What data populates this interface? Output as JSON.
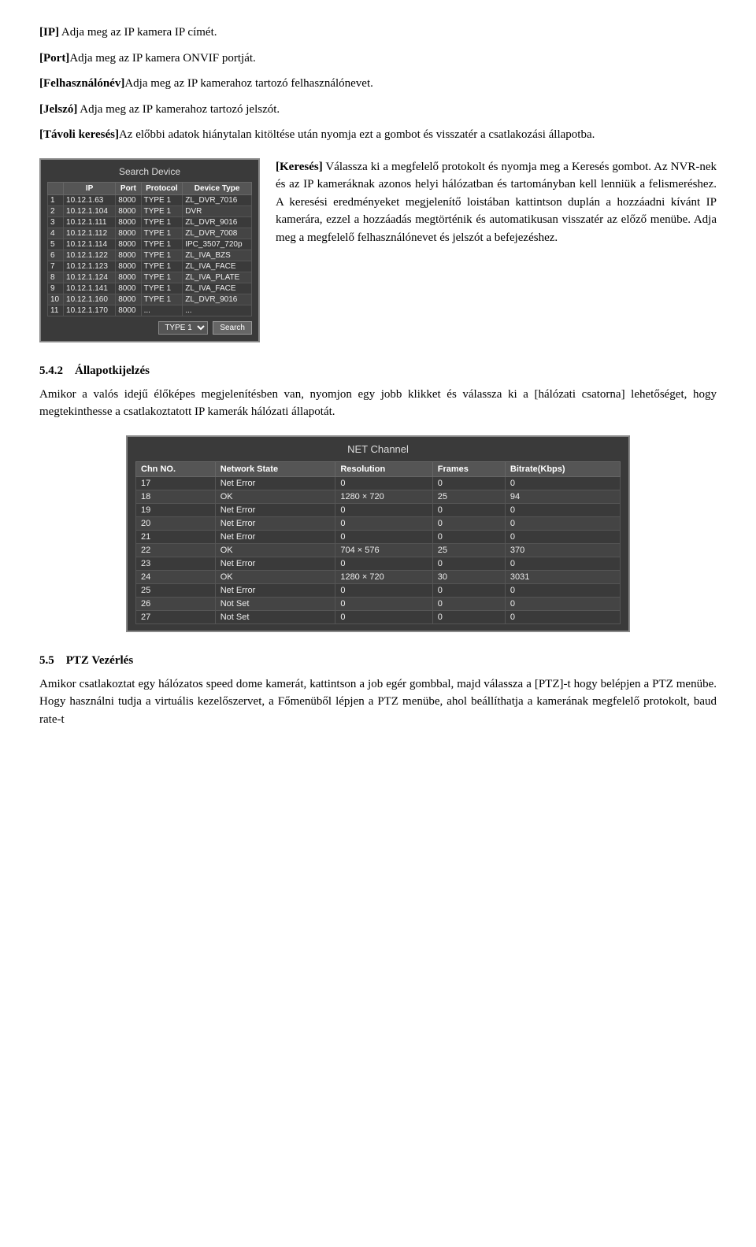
{
  "paragraphs": {
    "ip_label": "[IP]",
    "ip_text": " Adja meg az IP kamera IP címét.",
    "port_label": "[Port]",
    "port_text": "Adja meg az IP kamera ONVIF portját.",
    "username_label": "[Felhasználónév]",
    "username_text": "Adja meg az IP kamerahoz tartozó felhasználónevet.",
    "password_label": "[Jelszó]",
    "password_text": " Adja meg az IP kamerahoz tartozó jelszót.",
    "remote_label": "[Távoli keresés]",
    "remote_text": "Az előbbi adatok hiánytalan kitöltése után nyomja ezt a gombot és visszatér a csatlakozási állapotba."
  },
  "device_dialog": {
    "title": "Search Device",
    "columns": [
      "",
      "IP",
      "Port",
      "Protocol",
      "Device Type"
    ],
    "rows": [
      [
        "1",
        "10.12.1.63",
        "8000",
        "TYPE 1",
        "ZL_DVR_7016"
      ],
      [
        "2",
        "10.12.1.104",
        "8000",
        "TYPE 1",
        "DVR"
      ],
      [
        "3",
        "10.12.1.111",
        "8000",
        "TYPE 1",
        "ZL_DVR_9016"
      ],
      [
        "4",
        "10.12.1.112",
        "8000",
        "TYPE 1",
        "ZL_DVR_7008"
      ],
      [
        "5",
        "10.12.1.114",
        "8000",
        "TYPE 1",
        "IPC_3507_720p"
      ],
      [
        "6",
        "10.12.1.122",
        "8000",
        "TYPE 1",
        "ZL_IVA_BZS"
      ],
      [
        "7",
        "10.12.1.123",
        "8000",
        "TYPE 1",
        "ZL_IVA_FACE"
      ],
      [
        "8",
        "10.12.1.124",
        "8000",
        "TYPE 1",
        "ZL_IVA_PLATE"
      ],
      [
        "9",
        "10.12.1.141",
        "8000",
        "TYPE 1",
        "ZL_IVA_FACE"
      ],
      [
        "10",
        "10.12.1.160",
        "8000",
        "TYPE 1",
        "ZL_DVR_9016"
      ],
      [
        "11",
        "10.12.1.170",
        "8000",
        "...",
        "..."
      ]
    ],
    "dropdown_value": "TYPE 1",
    "search_button": "Search"
  },
  "right_column": {
    "keresés_label": "[Keresés]",
    "keresés_text1": "Válassza ki a megfelelő protokolt és nyomja meg a Keresés gombot. Az NVR-nek és az IP kameráknak azonos helyi hálózatban és tartományban kell lenniük a felismeréshez. A keresési eredményeket megjelenítő loistában kattintson duplán a hozzáadni kívánt IP kamerára, ezzel a hozzáadás megtörténik és automatikusan visszatér az előző menübe. Adja meg a megfelelő felhasználónevet és jelszót a befejezéshez."
  },
  "section_542": {
    "number": "5.4.2",
    "title": "Állapotkijelzés",
    "paragraph": "Amikor a valós idejű élőképes megjelenítésben van, nyomjon egy jobb klikket és válassza ki a [hálózati csatorna] lehetőséget, hogy megtekinthesse a csatlakoztatott IP kamerák hálózati állapotát."
  },
  "net_channel": {
    "title": "NET Channel",
    "columns": [
      "Chn NO.",
      "Network State",
      "Resolution",
      "Frames",
      "Bitrate(Kbps)"
    ],
    "rows": [
      [
        "17",
        "Net Error",
        "0",
        "0",
        "0"
      ],
      [
        "18",
        "OK",
        "1280 × 720",
        "25",
        "94"
      ],
      [
        "19",
        "Net Error",
        "0",
        "0",
        "0"
      ],
      [
        "20",
        "Net Error",
        "0",
        "0",
        "0"
      ],
      [
        "21",
        "Net Error",
        "0",
        "0",
        "0"
      ],
      [
        "22",
        "OK",
        "704 × 576",
        "25",
        "370"
      ],
      [
        "23",
        "Net Error",
        "0",
        "0",
        "0"
      ],
      [
        "24",
        "OK",
        "1280 × 720",
        "30",
        "3031"
      ],
      [
        "25",
        "Net Error",
        "0",
        "0",
        "0"
      ],
      [
        "26",
        "Not Set",
        "0",
        "0",
        "0"
      ],
      [
        "27",
        "Not Set",
        "0",
        "0",
        "0"
      ]
    ]
  },
  "section_55": {
    "number": "5.5",
    "title": "PTZ Vezérlés",
    "paragraph": "Amikor csatlakoztat egy hálózatos speed dome kamerát, kattintson a job egér gombbal, majd válassza a [PTZ]-t hogy belépjen a PTZ menübe. Hogy használni tudja a virtuális kezelőszervet, a Főmenüből lépjen a PTZ menübe, ahol beállíthatja a kamerának megfelelő protokolt, baud rate-t"
  }
}
